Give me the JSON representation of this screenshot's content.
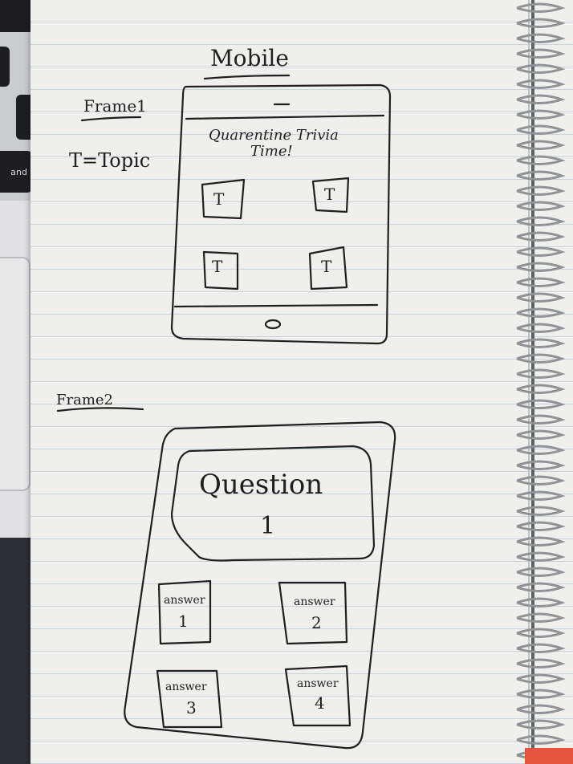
{
  "laptop": {
    "keys": [
      ">",
      "and"
    ]
  },
  "sketch": {
    "heading": "Mobile",
    "frame1": {
      "label": "Frame1",
      "legend": "T=Topic",
      "title_line1": "Quarentine Trivia",
      "title_line2": "Time!",
      "topic_tiles": [
        "T",
        "T",
        "T",
        "T"
      ]
    },
    "frame2": {
      "label": "Frame2",
      "question_line1": "Question",
      "question_line2": "1",
      "answers": [
        {
          "line1": "answer",
          "line2": "1"
        },
        {
          "line1": "answer",
          "line2": "2"
        },
        {
          "line1": "answer",
          "line2": "3"
        },
        {
          "line1": "answer",
          "line2": "4"
        }
      ]
    }
  },
  "colors": {
    "ink": "#1f1f1f",
    "paper": "#efefec",
    "rule": "#c9d3dd",
    "spiral": "#8f9296"
  }
}
